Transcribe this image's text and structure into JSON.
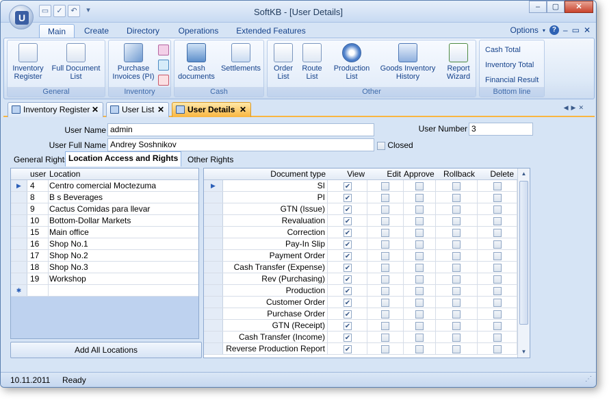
{
  "window": {
    "title": "SoftKB - [User Details]"
  },
  "ribbon_tabs": [
    {
      "label": "Main"
    },
    {
      "label": "Create"
    },
    {
      "label": "Directory"
    },
    {
      "label": "Operations"
    },
    {
      "label": "Extended Features"
    }
  ],
  "options_label": "Options",
  "ribbon": {
    "general": {
      "caption": "General",
      "inventory_register": "Inventory\nRegister",
      "full_document_list": "Full Document\nList"
    },
    "inventory": {
      "caption": "Inventory",
      "purchase_invoices": "Purchase\nInvoices (PI)"
    },
    "cash": {
      "caption": "Cash",
      "cash_documents": "Cash\ndocuments",
      "settlements": "Settlements"
    },
    "other": {
      "caption": "Other",
      "order_list": "Order\nList",
      "route_list": "Route\nList",
      "production_list": "Production\nList",
      "goods_inventory_history": "Goods Inventory\nHistory",
      "report_wizard": "Report\nWizard"
    },
    "bottom_line": {
      "caption": "Bottom line",
      "cash_total": "Cash Total",
      "inventory_total": "Inventory Total",
      "financial_result": "Financial Result"
    }
  },
  "doc_tabs": [
    {
      "label": "Inventory Register"
    },
    {
      "label": "User List"
    },
    {
      "label": "User Details"
    }
  ],
  "form": {
    "user_name_label": "User Name",
    "user_name": "admin",
    "user_full_name_label": "User Full Name",
    "user_full_name": "Andrey Soshnikov",
    "user_number_label": "User Number",
    "user_number": "3",
    "closed_label": "Closed"
  },
  "sub_tabs": [
    {
      "label": "General Rights"
    },
    {
      "label": "Location Access and Rights"
    },
    {
      "label": "Other Rights"
    }
  ],
  "locations": {
    "headers": {
      "user": "user",
      "location": "Location"
    },
    "rows": [
      {
        "user": "4",
        "location": "Centro comercial Moctezuma"
      },
      {
        "user": "8",
        "location": "B s Beverages"
      },
      {
        "user": "9",
        "location": "Cactus Comidas para llevar"
      },
      {
        "user": "10",
        "location": "Bottom-Dollar Markets"
      },
      {
        "user": "15",
        "location": "Main office"
      },
      {
        "user": "16",
        "location": "Shop No.1"
      },
      {
        "user": "17",
        "location": "Shop No.2"
      },
      {
        "user": "18",
        "location": "Shop No.3"
      },
      {
        "user": "19",
        "location": "Workshop"
      }
    ]
  },
  "add_all_locations": "Add All Locations",
  "rights": {
    "headers": {
      "document_type": "Document type",
      "view": "View",
      "edit": "Edit",
      "approve": "Approve",
      "rollback": "Rollback",
      "delete": "Delete"
    },
    "rows": [
      {
        "doc": "SI",
        "view": true
      },
      {
        "doc": "PI",
        "view": true
      },
      {
        "doc": "GTN (Issue)",
        "view": true
      },
      {
        "doc": "Revaluation",
        "view": true
      },
      {
        "doc": "Correction",
        "view": true
      },
      {
        "doc": "Pay-In Slip",
        "view": true
      },
      {
        "doc": "Payment Order",
        "view": true
      },
      {
        "doc": "Cash Transfer (Expense)",
        "view": true
      },
      {
        "doc": "Rev (Purchasing)",
        "view": true
      },
      {
        "doc": "Production",
        "view": true
      },
      {
        "doc": "Customer Order",
        "view": true
      },
      {
        "doc": "Purchase Order",
        "view": true
      },
      {
        "doc": "GTN (Receipt)",
        "view": true
      },
      {
        "doc": "Cash Transfer (Income)",
        "view": true
      },
      {
        "doc": "Reverse Production Report",
        "view": true
      }
    ]
  },
  "status": {
    "date": "10.11.2011",
    "state": "Ready"
  }
}
